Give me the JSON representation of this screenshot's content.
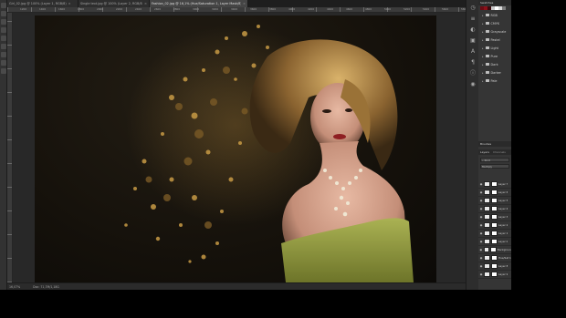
{
  "tabs": [
    {
      "label": "Girl_02.jpg @ 100% (Layer 1, RGB/8)",
      "close": "×",
      "active": false
    },
    {
      "label": "Single text.jpg @ 100% (Layer 2, RGB/8)",
      "close": "×",
      "active": false
    },
    {
      "label": "Fashion_02.jpg @ 16,1% (Hue/Saturation 1, Layer Mask/8)",
      "close": "×",
      "active": true
    }
  ],
  "ruler": {
    "ticks": [
      "1200",
      "1400",
      "1600",
      "1800",
      "2000",
      "2200",
      "2400",
      "2600",
      "2800",
      "3000",
      "3200",
      "3400",
      "3600",
      "3800",
      "4000",
      "4200",
      "4400",
      "4600",
      "4800",
      "5000",
      "5200",
      "5400",
      "5600",
      "5800"
    ]
  },
  "status": {
    "zoom": "16,07%",
    "doc": "Doc: 71,7M/1,18G"
  },
  "panels": {
    "swatches_tab": "Swatches",
    "swatch_colors": [
      "#6b0b14",
      "#8c1019",
      "#3b0a0f",
      "#c8c8c8",
      "#ffffff",
      "#d9d9d9",
      "#7a7a7a"
    ],
    "folders": [
      "RGB",
      "CMYK",
      "Grayscale",
      "Pastel",
      "Light",
      "Pure",
      "Dark",
      "Darker",
      "Pale"
    ],
    "brushes_tab": "Brushes",
    "layers_tab": "Layers",
    "channels_tab": "Channels",
    "kind_label": "Kind",
    "blend_mode": "Multiply",
    "layers": [
      {
        "name": "Layer 7"
      },
      {
        "name": "Layer 6"
      },
      {
        "name": "Layer 5"
      },
      {
        "name": "Layer 4"
      },
      {
        "name": "Layer 3"
      },
      {
        "name": "Layer 2"
      },
      {
        "name": "Layer 1"
      },
      {
        "name": "Layer 0"
      },
      {
        "name": "Background"
      },
      {
        "name": "Hue/Sat 1"
      },
      {
        "name": "Layer 8"
      },
      {
        "name": "Layer 9"
      }
    ]
  },
  "icons": {
    "eye": "eye-icon",
    "folder": "folder-icon"
  }
}
